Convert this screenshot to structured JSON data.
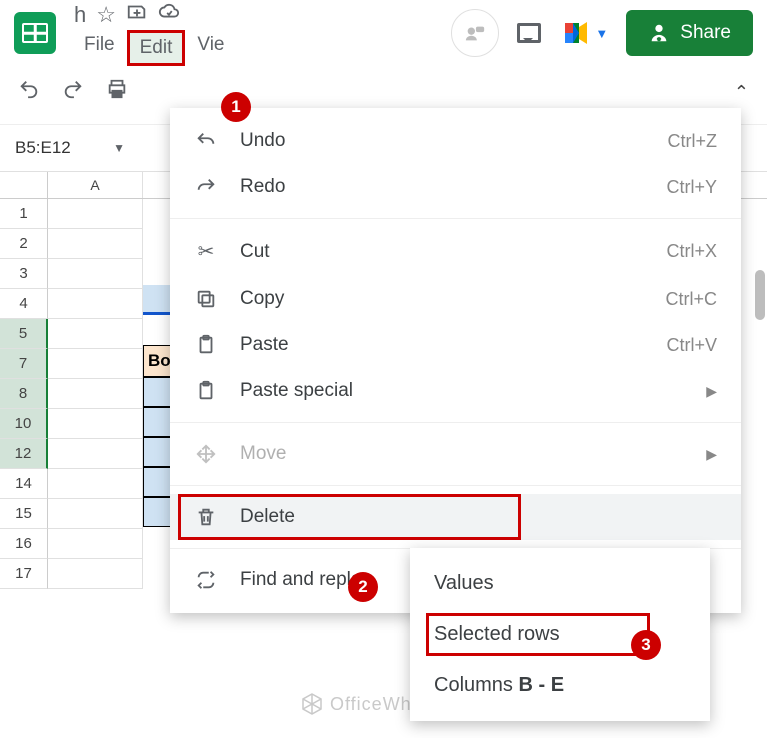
{
  "header": {
    "doc_title": "h",
    "menus": {
      "file": "File",
      "edit": "Edit",
      "view": "Vie"
    },
    "share_label": "Share"
  },
  "namebox": {
    "value": "B5:E12"
  },
  "columns": {
    "a": "A"
  },
  "rows": [
    "1",
    "2",
    "3",
    "4",
    "5",
    "7",
    "8",
    "10",
    "12",
    "14",
    "15",
    "16",
    "17"
  ],
  "visible_cell_b4": "Bo",
  "menu": {
    "undo": {
      "label": "Undo",
      "shortcut": "Ctrl+Z"
    },
    "redo": {
      "label": "Redo",
      "shortcut": "Ctrl+Y"
    },
    "cut": {
      "label": "Cut",
      "shortcut": "Ctrl+X"
    },
    "copy": {
      "label": "Copy",
      "shortcut": "Ctrl+C"
    },
    "paste": {
      "label": "Paste",
      "shortcut": "Ctrl+V"
    },
    "paste_special": {
      "label": "Paste special"
    },
    "move": {
      "label": "Move"
    },
    "delete": {
      "label": "Delete"
    },
    "find_replace": {
      "label": "Find and replac"
    }
  },
  "submenu": {
    "values": "Values",
    "selected_rows": "Selected rows",
    "columns": "Columns B - E"
  },
  "annotations": {
    "b1": "1",
    "b2": "2",
    "b3": "3"
  },
  "watermark": "OfficeWheel"
}
